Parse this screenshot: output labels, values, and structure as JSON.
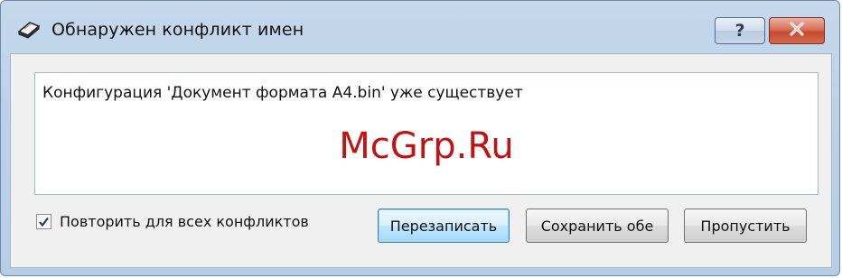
{
  "window": {
    "title": "Обнаружен конфликт имен",
    "help_label": "?",
    "icons": {
      "app": "scanner-icon",
      "close": "close-icon"
    }
  },
  "message": {
    "text": "Конфигурация 'Документ формата A4.bin' уже существует",
    "watermark": "McGrp.Ru"
  },
  "checkbox": {
    "label": "Повторить для всех конфликтов",
    "checked": true
  },
  "buttons": {
    "overwrite": "Перезаписать",
    "keep_both": "Сохранить обе",
    "skip": "Пропустить"
  },
  "colors": {
    "watermark": "#c21212",
    "default_button_border": "#3c7fb1",
    "close_button": "#c74a2f"
  }
}
